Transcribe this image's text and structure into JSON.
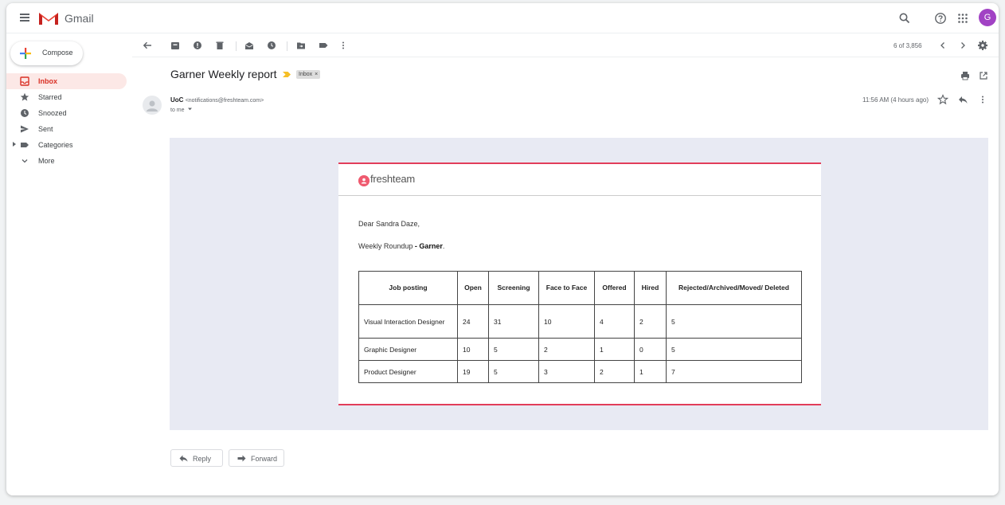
{
  "app": {
    "brand": "Gmail",
    "avatar_letter": "G",
    "avatar_color": "#a142c4",
    "accent": "#d93025"
  },
  "compose": {
    "label": "Compose"
  },
  "sidebar": {
    "items": [
      {
        "label": "Inbox",
        "icon": "inbox-icon",
        "active": true
      },
      {
        "label": "Starred",
        "icon": "star-icon"
      },
      {
        "label": "Snoozed",
        "icon": "clock-icon"
      },
      {
        "label": "Sent",
        "icon": "send-icon"
      },
      {
        "label": "Categories",
        "icon": "label-icon"
      },
      {
        "label": "More",
        "icon": "chevron-down-icon"
      }
    ]
  },
  "toolbar": {
    "pager": "6 of 3,856"
  },
  "message": {
    "subject": "Garner Weekly report",
    "label_chip": "Inbox",
    "label_chip_close": "×",
    "sender_name": "UoC",
    "sender_address": "<notifications@freshteam.com>",
    "to_line": "to me",
    "time": "11:56 AM (4 hours ago)"
  },
  "email": {
    "brand": "freshteam",
    "brand_color": "#e23d5a",
    "greeting": "Dear Sandra Daze,",
    "roundup_prefix": "Weekly Roundup",
    "roundup_bold": "- Garner",
    "roundup_suffix": ".",
    "table": {
      "headers": [
        "Job posting",
        "Open",
        "Screening",
        "Face to Face",
        "Offered",
        "Hired",
        "Rejected/Archived/Moved/ Deleted"
      ],
      "rows": [
        [
          "Visual Interaction Designer",
          "24",
          "31",
          "10",
          "4",
          "2",
          "5"
        ],
        [
          "Graphic Designer",
          "10",
          "5",
          "2",
          "1",
          "0",
          "5"
        ],
        [
          "Product Designer",
          "19",
          "5",
          "3",
          "2",
          "1",
          "7"
        ]
      ]
    }
  },
  "actions": {
    "reply": "Reply",
    "forward": "Forward"
  }
}
